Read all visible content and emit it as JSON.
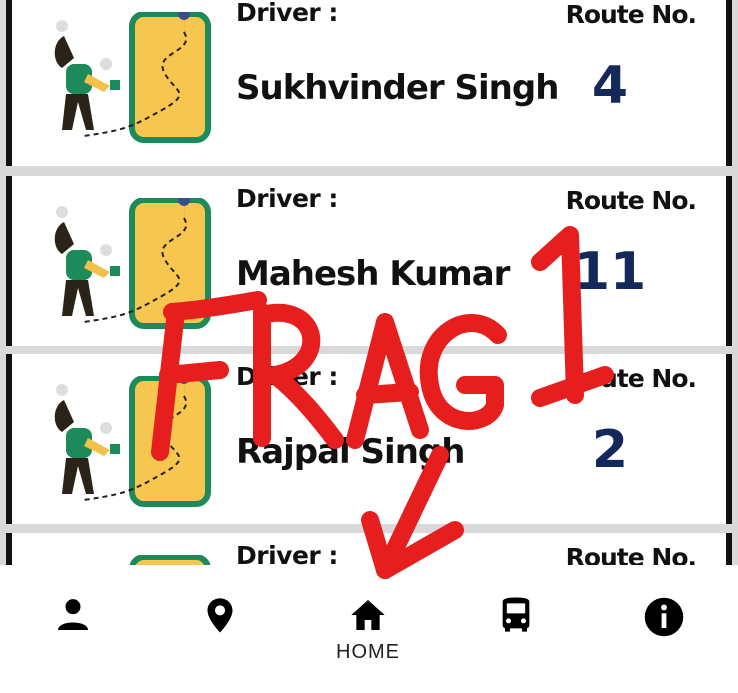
{
  "cards": [
    {
      "driver_label": "Driver :",
      "driver_name": "Sukhvinder Singh",
      "route_label": "Route No.",
      "route_no": "4"
    },
    {
      "driver_label": "Driver :",
      "driver_name": "Mahesh Kumar",
      "route_label": "Route No.",
      "route_no": "11"
    },
    {
      "driver_label": "Driver :",
      "driver_name": "Rajpal Singh",
      "route_label": "Route No.",
      "route_no": "2"
    },
    {
      "driver_label": "Driver :",
      "driver_name": "",
      "route_label": "Route No.",
      "route_no": ""
    }
  ],
  "nav": {
    "items": [
      {
        "icon": "person-icon",
        "label": ""
      },
      {
        "icon": "location-pin-icon",
        "label": ""
      },
      {
        "icon": "home-icon",
        "label": "HOME"
      },
      {
        "icon": "bus-icon",
        "label": ""
      },
      {
        "icon": "info-icon",
        "label": ""
      }
    ]
  },
  "annotation": {
    "text": "FRAG1",
    "color": "#e61e1e"
  },
  "colors": {
    "route_number": "#14285a",
    "phone_fill": "#f7c64f",
    "phone_border": "#1c8a5a"
  }
}
